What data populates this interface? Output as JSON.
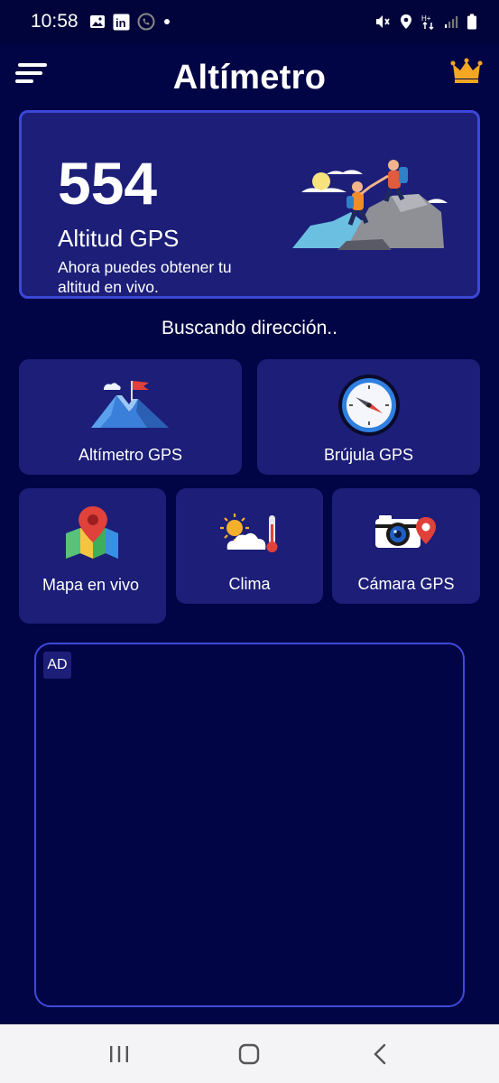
{
  "status_bar": {
    "time": "10:58",
    "icons": [
      "gallery-icon",
      "linkedin-icon",
      "phone-icon",
      "dot-icon",
      "mute-icon",
      "location-icon",
      "data-icon",
      "signal-icon",
      "battery-icon"
    ],
    "linkedin_text": "in"
  },
  "header": {
    "title": "Altímetro",
    "menu_icon": "menu-icon",
    "premium_icon": "crown-icon"
  },
  "altitude_card": {
    "value": "554",
    "label": "Altitud GPS",
    "description": "Ahora puedes obtener tu altitud en vivo."
  },
  "location_status": "Buscando dirección..",
  "tiles": {
    "altimeter": {
      "label": "Altímetro GPS",
      "icon": "mountain-flag-icon"
    },
    "compass": {
      "label": "Brújula GPS",
      "icon": "compass-icon"
    },
    "map": {
      "label": "Mapa en vivo",
      "icon": "map-pin-icon"
    },
    "weather": {
      "label": "Clima",
      "icon": "weather-icon"
    },
    "camera": {
      "label": "Cámara GPS",
      "icon": "camera-pin-icon"
    }
  },
  "ad": {
    "badge": "AD"
  },
  "nav": {
    "recents": "recents-icon",
    "home": "home-icon",
    "back": "back-icon"
  },
  "colors": {
    "background": "#010545",
    "card": "#1c1e78",
    "card_border": "#3b47d6",
    "nav_bar": "#f4f4f6",
    "crown": "#f5a623"
  }
}
